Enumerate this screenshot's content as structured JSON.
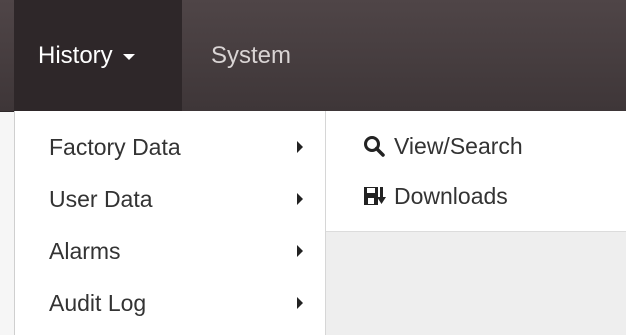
{
  "navbar": {
    "items": [
      {
        "label": "History",
        "active": true,
        "has_caret": true,
        "icon": "caret-down-icon"
      },
      {
        "label": "System",
        "active": false
      }
    ],
    "background": "#4a4143",
    "active_background": "#2e2729"
  },
  "history_menu": {
    "items": [
      {
        "label": "Factory Data",
        "icon": "chevron-right-icon"
      },
      {
        "label": "User Data",
        "icon": "chevron-right-icon"
      },
      {
        "label": "Alarms",
        "icon": "chevron-right-icon"
      },
      {
        "label": "Audit Log",
        "icon": "chevron-right-icon"
      }
    ]
  },
  "submenu": {
    "items": [
      {
        "label": "View/Search",
        "icon": "search-icon"
      },
      {
        "label": "Downloads",
        "icon": "download-icon"
      }
    ]
  }
}
